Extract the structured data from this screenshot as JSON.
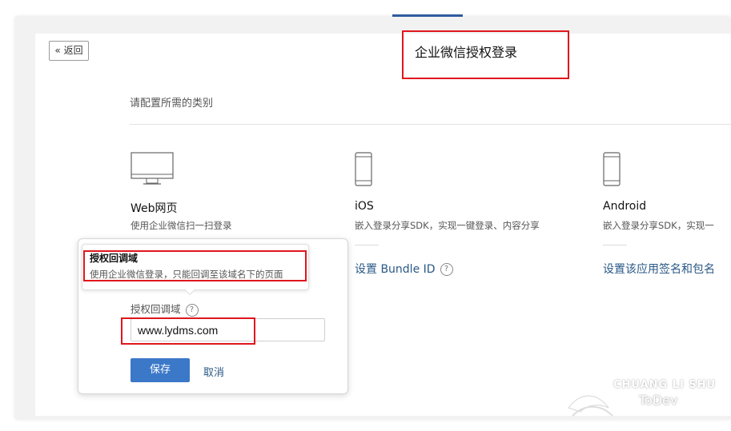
{
  "back_button": {
    "icon": "double-chevron-left-icon",
    "label": "返回"
  },
  "page_title": "企业微信授权登录",
  "section_label": "请配置所需的类别",
  "platforms": [
    {
      "icon": "desktop-monitor-icon",
      "title": "Web网页",
      "desc": "使用企业微信扫一扫登录"
    },
    {
      "icon": "phone-icon",
      "title": "iOS",
      "desc": "嵌入登录分享SDK，实现一键登录、内容分享",
      "link": "设置 Bundle ID"
    },
    {
      "icon": "phone-icon",
      "title": "Android",
      "desc": "嵌入登录分享SDK，实现一",
      "link": "设置该应用签名和包名"
    }
  ],
  "popup": {
    "tooltip_title": "授权回调域",
    "tooltip_desc": "使用企业微信登录，只能回调至该域名下的页面",
    "field_label": "授权回调域",
    "field_value": "www.lydms.com",
    "save_label": "保存",
    "cancel_label": "取消"
  },
  "help_glyph": "?",
  "watermark": {
    "line1": "CHUANG LI SHU",
    "line2": "ToDev"
  },
  "colors": {
    "accent": "#3b78c8",
    "link": "#2a5886",
    "annotation": "#e0161d"
  }
}
